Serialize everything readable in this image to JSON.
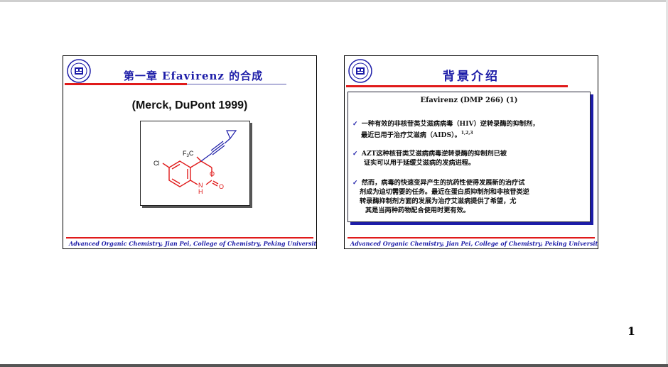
{
  "page_number": "1",
  "left_slide": {
    "title": "第一章  Efavirenz 的合成",
    "subtitle": "(Merck, DuPont 1999)",
    "molecule": {
      "labels": {
        "cl": "Cl",
        "cf3": "F3C",
        "n": "N",
        "h": "H",
        "o_ring": "O",
        "o_carbonyl": "O"
      }
    },
    "footer": "Advanced Organic Chemistry, Jian Pei, College of Chemistry, Peking University,"
  },
  "right_slide": {
    "title": "背景介绍",
    "panel_heading": "Efavirenz (DMP 266) (1)",
    "bullets": [
      {
        "line1": "一种有效的非核苷类艾滋病病毒（HIV）逆转录酶的抑制剂，",
        "line2": "最近已用于治疗艾滋病（AIDS）。",
        "superscript": "1,2,3"
      },
      {
        "line1": "AZT这种核苷类艾滋病病毒逆转录酶的抑制剂已被",
        "line2": "证实可以用于延缓艾滋病的发病进程。"
      },
      {
        "line1": "然而，病毒的快速变异产生的抗药性使得发展新的治疗试",
        "line2": "剂成为迫切需要的任务。最近在蛋白质抑制剂和非核苷类逆",
        "line3": "转录酶抑制剂方面的发展为治疗艾滋病提供了希望，尤",
        "line4": "其是当两种药物配合使用时更有效。"
      }
    ],
    "footer": "Advanced Organic Chemistry, Jian Pei, College of Chemistry, Peking University,"
  },
  "colors": {
    "title_blue": "#1d1da8",
    "rule_red": "#e01a1a",
    "molecule_red": "#e01a1a",
    "molecule_blue": "#1d1da8"
  }
}
